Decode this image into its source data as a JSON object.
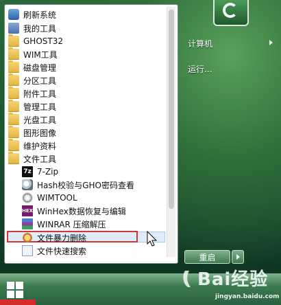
{
  "start_menu": {
    "programs": [
      {
        "label": "刷新系统",
        "icon": "refresh-app-icon"
      },
      {
        "label": "我的工具",
        "icon": "tools-app-icon"
      },
      {
        "label": "GHOST32",
        "icon": "folder-icon"
      },
      {
        "label": "WIM工具",
        "icon": "folder-icon"
      },
      {
        "label": "磁盘管理",
        "icon": "folder-icon"
      },
      {
        "label": "分区工具",
        "icon": "folder-icon"
      },
      {
        "label": "附件工具",
        "icon": "folder-icon"
      },
      {
        "label": "管理工具",
        "icon": "folder-icon"
      },
      {
        "label": "光盘工具",
        "icon": "folder-icon"
      },
      {
        "label": "图形图像",
        "icon": "folder-icon"
      },
      {
        "label": "维护资料",
        "icon": "folder-icon"
      },
      {
        "label": "文件工具",
        "icon": "folder-icon"
      }
    ],
    "file_tools": [
      {
        "label": "7-Zip",
        "icon": "7zip-icon",
        "icon_text": "7z"
      },
      {
        "label": "Hash校验与GHO密码查看",
        "icon": "hash-icon"
      },
      {
        "label": "WIMTOOL",
        "icon": "wimtool-icon"
      },
      {
        "label": "WinHex数据恢复与编辑",
        "icon": "winhex-icon",
        "icon_text": "HEX"
      },
      {
        "label": "WINRAR 压缩解压",
        "icon": "winrar-icon"
      },
      {
        "label": "文件暴力删除",
        "icon": "force-delete-icon"
      },
      {
        "label": "文件快速搜索",
        "icon": "file-search-icon"
      }
    ],
    "highlighted_item": "文件暴力删除",
    "right_panel": {
      "computer": "计算机",
      "run": "运行..."
    },
    "restart_button": "重启"
  },
  "watermark": {
    "brand": "Bai经验",
    "url": "jingyan.baidu.com"
  },
  "colors": {
    "highlight_border": "#d6323a",
    "selection_fill": "#dcecf8",
    "taskbar": "#3c7a4f"
  }
}
